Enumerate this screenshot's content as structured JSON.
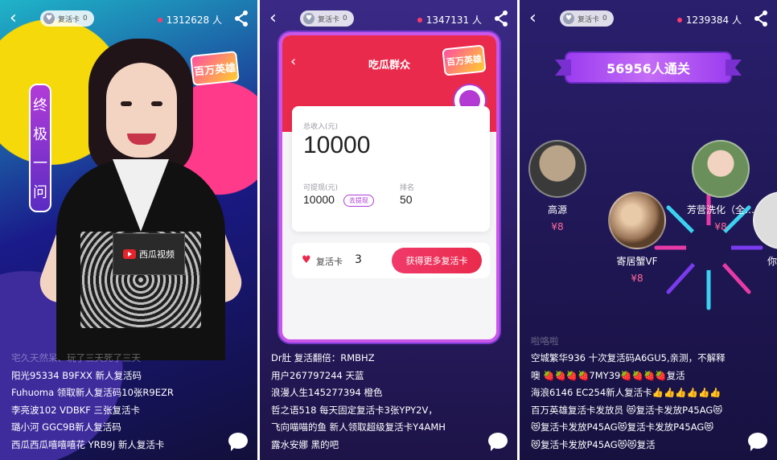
{
  "panels": [
    {
      "top": {
        "revive_label": "复活卡",
        "revive_count": "0",
        "viewers": "1312628 人"
      },
      "logo": "百万英雄",
      "final_question": [
        "终",
        "极",
        "一",
        "问"
      ],
      "card_text": "西瓜视频",
      "chat": [
        {
          "user": "宅久天然呆、玩了三天死了三天",
          "msg": ""
        },
        {
          "user": "阳光95334",
          "msg": "B9FXX      新人复活码"
        },
        {
          "user": "Fuhuoma",
          "msg": "领取新人复活码10张R9EZR"
        },
        {
          "user": "李亮波102",
          "msg": "VDBKF 三张复活卡"
        },
        {
          "user": "璐小河",
          "msg": "GGC9B新人复活码"
        },
        {
          "user": "西瓜西瓜嘻嘻嘻花",
          "msg": "YRB9J 新人复活卡"
        }
      ]
    },
    {
      "top": {
        "revive_label": "复活卡",
        "revive_count": "0",
        "viewers": "1347131 人"
      },
      "card": {
        "title": "吃瓜群众",
        "logo": "百万英雄",
        "total_label": "总收入(元)",
        "total": "10000",
        "withdrawable_label": "可提现(元)",
        "withdrawable": "10000",
        "withdraw_btn": "去提现",
        "rank_label": "排名",
        "rank": "50",
        "revive_label": "复活卡",
        "revive_count": "3",
        "more_btn": "获得更多复活卡"
      },
      "chat": [
        {
          "user": "Dr肚",
          "msg": "复活翻倍：RMBHZ"
        },
        {
          "user": "用户267797244",
          "msg": "天蓝"
        },
        {
          "user": "浪漫人生145277394",
          "msg": "橙色"
        },
        {
          "user": "哲之语518",
          "msg": "每天固定复活卡3张YPY2V，"
        },
        {
          "user": "飞向喵喵的鱼",
          "msg": "新人领取超级复活卡Y4AMH"
        },
        {
          "user": "露水安娜",
          "msg": "黑的吧"
        }
      ]
    },
    {
      "top": {
        "revive_label": "复活卡",
        "revive_count": "0",
        "viewers": "1239384 人"
      },
      "banner": "56956人通关",
      "winners": [
        {
          "name": "高源",
          "prize": "¥8"
        },
        {
          "name": "芳营洗化（全…",
          "prize": "¥8"
        },
        {
          "name": "寄居蟹VF",
          "prize": "¥8"
        },
        {
          "name": "你晓",
          "prize": ""
        }
      ],
      "chat": [
        {
          "user": "啦咯啦",
          "msg": ""
        },
        {
          "user": "空城繁华936",
          "msg": "十次复活码A6GU5,亲测，不解释"
        },
        {
          "user": "噢",
          "msg": "🍓🍓🍓🍓7MY39🍓🍓🍓🍓复活"
        },
        {
          "user": "海浪6146",
          "msg": "EC254新人复活卡👍👍👍👍👍👍"
        },
        {
          "user": "百万英雄复活卡发放员",
          "msg": "😻复活卡发放P45AG😻"
        },
        {
          "user": "😻复活卡发放P45AG😻",
          "msg": "复活卡发放P45AG😻"
        },
        {
          "user": "😻复活卡发放P45AG😻",
          "msg": "😻复活"
        }
      ]
    }
  ],
  "colors": {
    "accent_red": "#ea2a4c",
    "accent_purple": "#b03bd8"
  }
}
